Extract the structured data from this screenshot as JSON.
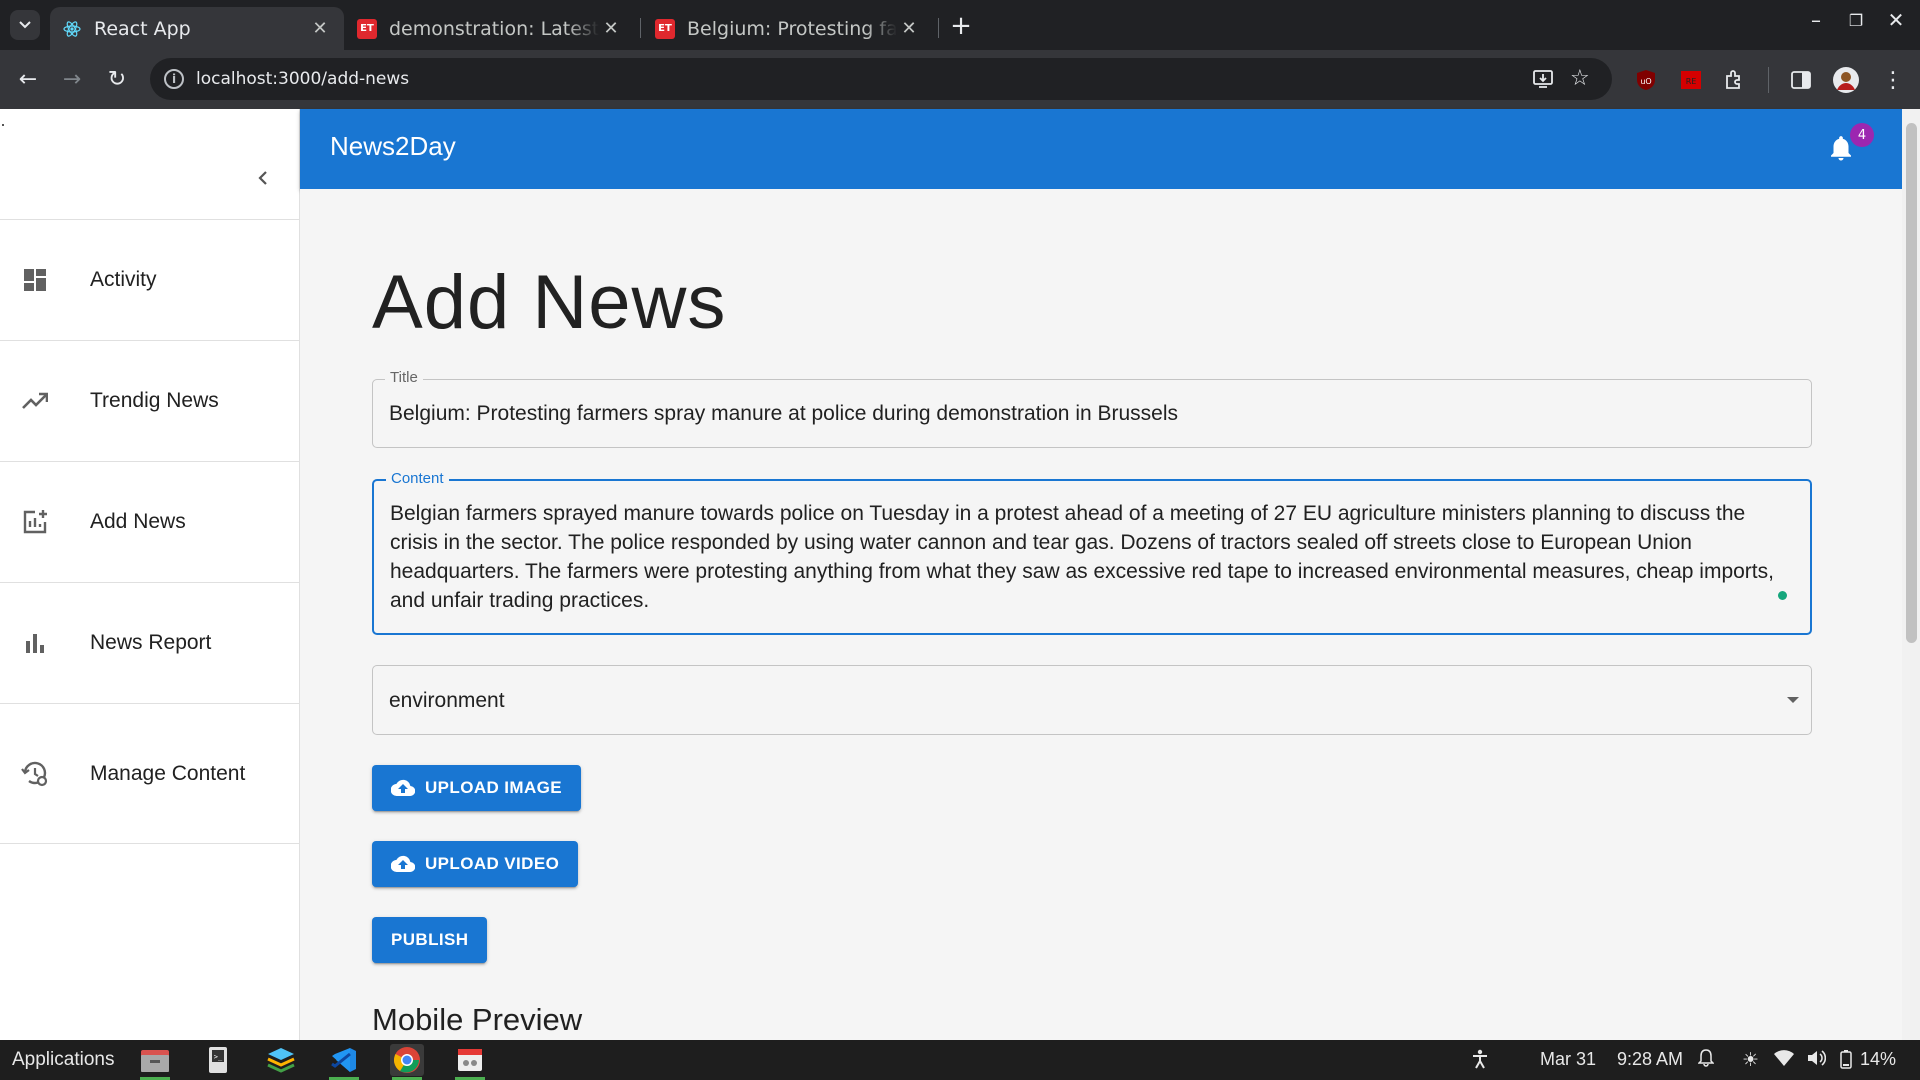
{
  "browser": {
    "tabs": [
      {
        "title": "React App",
        "active": true
      },
      {
        "title": "demonstration: Latest News",
        "active": false
      },
      {
        "title": "Belgium: Protesting farmers",
        "active": false
      }
    ],
    "url": "localhost:3000/add-news"
  },
  "sidebar": {
    "items": [
      {
        "label": "Activity",
        "icon": "dashboard-icon"
      },
      {
        "label": "Trendig News",
        "icon": "trending-up-icon"
      },
      {
        "label": "Add News",
        "icon": "add-chart-icon"
      },
      {
        "label": "News Report",
        "icon": "bar-chart-icon"
      },
      {
        "label": "Manage Content",
        "icon": "manage-history-icon"
      }
    ]
  },
  "appbar": {
    "brand": "News2Day",
    "notification_count": "4"
  },
  "form": {
    "page_title": "Add News",
    "title_label": "Title",
    "title_value": "Belgium: Protesting farmers spray manure at police during demonstration in Brussels",
    "content_label": "Content",
    "content_value": "Belgian farmers sprayed manure towards police on Tuesday in a protest ahead of a meeting of 27 EU agriculture ministers planning to discuss the crisis in the sector. The police responded by using water cannon and tear gas. Dozens of tractors sealed off streets close to European Union headquarters. The farmers were protesting anything from what they saw as excessive red tape to increased environmental measures, cheap imports, and unfair trading practices.",
    "category_value": "environment",
    "upload_image_label": "UPLOAD IMAGE",
    "upload_video_label": "UPLOAD VIDEO",
    "publish_label": "PUBLISH",
    "mobile_preview_heading": "Mobile Preview"
  },
  "taskbar": {
    "applications_label": "Applications",
    "date": "Mar 31",
    "time": "9:28 AM",
    "battery": "14%"
  },
  "colors": {
    "primary": "#1976d2",
    "badge": "#9c27b0"
  }
}
